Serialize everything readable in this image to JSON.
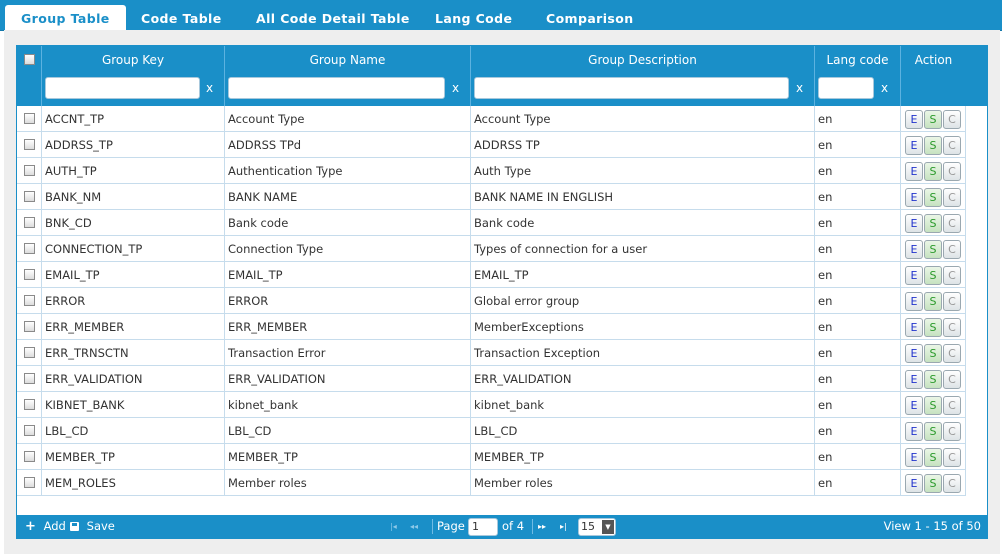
{
  "tabs": [
    {
      "label": "Group Table",
      "active": true
    },
    {
      "label": "Code Table",
      "active": false
    },
    {
      "label": "All Code Detail Table",
      "active": false
    },
    {
      "label": "Lang Code",
      "active": false
    },
    {
      "label": "Comparison",
      "active": false
    }
  ],
  "grid": {
    "columns": [
      "Group Key",
      "Group Name",
      "Group Description",
      "Lang code",
      "Action"
    ],
    "filter_clear_glyph": "x",
    "action_buttons": [
      "E",
      "S",
      "C"
    ],
    "rows": [
      {
        "key": "ACCNT_TP",
        "name": "Account Type",
        "desc": "Account Type",
        "lang": "en"
      },
      {
        "key": "ADDRSS_TP",
        "name": "ADDRSS TPd",
        "desc": "ADDRSS TP",
        "lang": "en"
      },
      {
        "key": "AUTH_TP",
        "name": "Authentication Type",
        "desc": "Auth Type",
        "lang": "en"
      },
      {
        "key": "BANK_NM",
        "name": "BANK NAME",
        "desc": "BANK NAME IN ENGLISH",
        "lang": "en"
      },
      {
        "key": "BNK_CD",
        "name": "Bank code",
        "desc": "Bank code",
        "lang": "en"
      },
      {
        "key": "CONNECTION_TP",
        "name": "Connection Type",
        "desc": "Types of connection for a user",
        "lang": "en"
      },
      {
        "key": "EMAIL_TP",
        "name": "EMAIL_TP",
        "desc": "EMAIL_TP",
        "lang": "en"
      },
      {
        "key": "ERROR",
        "name": "ERROR",
        "desc": "Global error group",
        "lang": "en"
      },
      {
        "key": "ERR_MEMBER",
        "name": "ERR_MEMBER",
        "desc": "MemberExceptions",
        "lang": "en"
      },
      {
        "key": "ERR_TRNSCTN",
        "name": "Transaction Error",
        "desc": "Transaction Exception",
        "lang": "en"
      },
      {
        "key": "ERR_VALIDATION",
        "name": "ERR_VALIDATION",
        "desc": "ERR_VALIDATION",
        "lang": "en"
      },
      {
        "key": "KIBNET_BANK",
        "name": "kibnet_bank",
        "desc": "kibnet_bank",
        "lang": "en"
      },
      {
        "key": "LBL_CD",
        "name": "LBL_CD",
        "desc": "LBL_CD",
        "lang": "en"
      },
      {
        "key": "MEMBER_TP",
        "name": "MEMBER_TP",
        "desc": "MEMBER_TP",
        "lang": "en"
      },
      {
        "key": "MEM_ROLES",
        "name": "Member roles",
        "desc": "Member roles",
        "lang": "en"
      }
    ]
  },
  "pager": {
    "add_label": "Add",
    "save_label": "Save",
    "first_glyph": "|◂",
    "prev_glyph": "◂◂",
    "next_glyph": "▸▸",
    "last_glyph": "▸|",
    "page_label": "Page",
    "page_value": "1",
    "of_label": "of 4",
    "rows_per_page": "15",
    "view_text": "View 1 - 15 of 50"
  },
  "colors": {
    "header_blue": "#1a8fc8",
    "panel_gray": "#eeeeee"
  },
  "icons": {
    "add": "plus-icon",
    "save": "disk-icon",
    "dropdown": "caret-down-icon"
  }
}
